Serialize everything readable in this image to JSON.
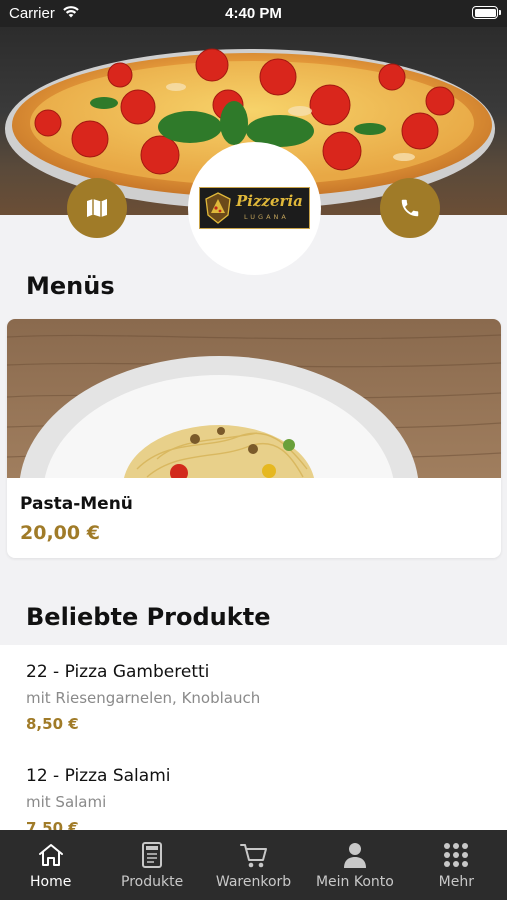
{
  "status_bar": {
    "carrier": "Carrier",
    "time": "4:40 PM"
  },
  "logo": {
    "brand": "Pizzeria",
    "sub": "LUGANA"
  },
  "menus": {
    "title": "Menüs",
    "items": [
      {
        "name": "Pasta-Menü",
        "price": "20,00 €"
      }
    ]
  },
  "popular": {
    "title": "Beliebte Produkte",
    "items": [
      {
        "name": "22 - Pizza Gamberetti",
        "description": "mit Riesengarnelen, Knoblauch",
        "price": "8,50 €"
      },
      {
        "name": "12 - Pizza Salami",
        "description": "mit Salami",
        "price": "7,50 €"
      }
    ]
  },
  "tabbar": {
    "items": [
      {
        "label": "Home",
        "icon": "home-icon"
      },
      {
        "label": "Produkte",
        "icon": "menu-book-icon"
      },
      {
        "label": "Warenkorb",
        "icon": "cart-icon"
      },
      {
        "label": "Mein Konto",
        "icon": "user-icon"
      },
      {
        "label": "Mehr",
        "icon": "grid-icon"
      }
    ]
  },
  "colors": {
    "accent": "#a07b28",
    "tabbar": "#2c2c2c",
    "background": "#f2f2f4"
  }
}
